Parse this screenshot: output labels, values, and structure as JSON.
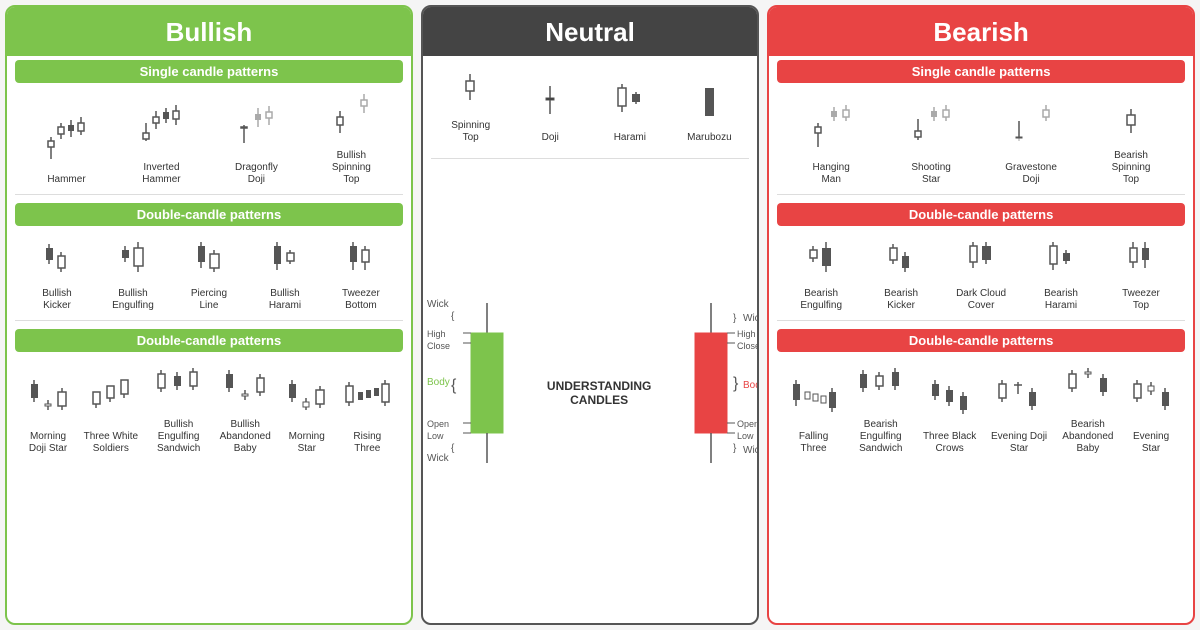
{
  "bullish": {
    "header": "Bullish",
    "single_header": "Single candle patterns",
    "single_patterns": [
      {
        "label": "Hammer"
      },
      {
        "label": "Inverted\nHammer"
      },
      {
        "label": "Dragonfly\nDoji"
      },
      {
        "label": "Bullish\nSpinning\nTop"
      }
    ],
    "double_header": "Double-candle patterns",
    "double_patterns": [
      {
        "label": "Bullish\nKicker"
      },
      {
        "label": "Bullish\nEngulfing"
      },
      {
        "label": "Piercing\nLine"
      },
      {
        "label": "Bullish\nHarami"
      },
      {
        "label": "Tweezer\nBottom"
      }
    ],
    "triple_header": "Double-candle patterns",
    "triple_patterns": [
      {
        "label": "Morning\nDoji Star"
      },
      {
        "label": "Three White\nSoldiers"
      },
      {
        "label": "Bullish\nEngulfing\nSandwich"
      },
      {
        "label": "Bullish\nAbandoned\nBaby"
      },
      {
        "label": "Morning\nStar"
      },
      {
        "label": "Rising\nThree"
      }
    ]
  },
  "neutral": {
    "header": "Neutral",
    "patterns": [
      {
        "label": "Spinning\nTop"
      },
      {
        "label": "Doji"
      },
      {
        "label": "Harami"
      },
      {
        "label": "Marubozu"
      }
    ],
    "understand_title": "UNDERSTANDING\nCANDLES"
  },
  "bearish": {
    "header": "Bearish",
    "single_header": "Single candle patterns",
    "single_patterns": [
      {
        "label": "Hanging\nMan"
      },
      {
        "label": "Shooting\nStar"
      },
      {
        "label": "Gravestone\nDoji"
      },
      {
        "label": "Bearish\nSpinning\nTop"
      }
    ],
    "double_header": "Double-candle patterns",
    "double_patterns": [
      {
        "label": "Bearish\nEngulfing"
      },
      {
        "label": "Bearish\nKicker"
      },
      {
        "label": "Dark Cloud\nCover"
      },
      {
        "label": "Bearish\nHarami"
      },
      {
        "label": "Tweezer\nTop"
      }
    ],
    "triple_header": "Double-candle patterns",
    "triple_patterns": [
      {
        "label": "Falling\nThree"
      },
      {
        "label": "Bearish\nEngulfing\nSandwich"
      },
      {
        "label": "Three Black\nCrows"
      },
      {
        "label": "Evening Doji\nStar"
      },
      {
        "label": "Bearish\nAbandoned\nBaby"
      },
      {
        "label": "Evening\nStar"
      }
    ]
  }
}
